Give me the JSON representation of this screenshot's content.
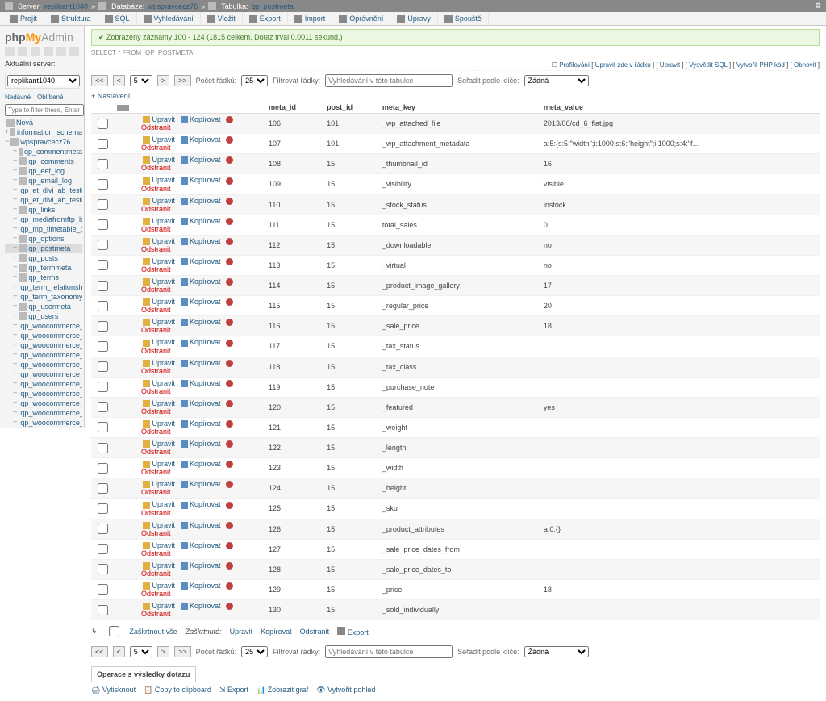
{
  "logo": {
    "php": "php",
    "my": "My",
    "admin": "Admin"
  },
  "header": {
    "server_label": "Server:",
    "server": "replikant1040",
    "db_label": "Databáze:",
    "db": "wpspravcecz76",
    "table_label": "Tabulka:",
    "table": "qp_postmeta"
  },
  "tabs": [
    "Projít",
    "Struktura",
    "SQL",
    "Vyhledávání",
    "Vložit",
    "Export",
    "Import",
    "Oprávnění",
    "Úpravy",
    "Spouště"
  ],
  "sidebar": {
    "current_server": "Aktuální server:",
    "server_value": "replikant1040",
    "smalltabs": [
      "Nedávné",
      "Oblíbené"
    ],
    "nova": "Nová",
    "filter_placeholder": "Type to filter these, Enter to search all",
    "dbs": [
      "information_schema",
      "wpspravcecz76"
    ],
    "tables": [
      "qp_commentmeta",
      "qp_comments",
      "qp_eef_log",
      "qp_email_log",
      "qp_et_divi_ab_testing_clienta",
      "qp_et_divi_ab_testing_stats",
      "qp_links",
      "qp_mediafromftp_log",
      "qp_mp_timetable_data",
      "qp_options",
      "qp_postmeta",
      "qp_posts",
      "qp_termmeta",
      "qp_terms",
      "qp_term_relationships",
      "qp_term_taxonomy",
      "qp_usermeta",
      "qp_users",
      "qp_woocommerce_api_keys",
      "qp_woocommerce_attribute_t",
      "qp_woocommerce_download",
      "qp_woocommerce_log",
      "qp_woocommerce_order_item",
      "qp_woocommerce_order_iten",
      "qp_woocommerce_payment_",
      "qp_woocommerce_sessions",
      "qp_woocommerce_shipping_",
      "qp_woocommerce_shipping_",
      "qp_woocommerce_shipping_",
      "qp_woocommerce_tax_rates",
      "qp_woocommerce_tax_rate_l"
    ],
    "selected_table": "qp_postmeta"
  },
  "success": "Zobrazeny záznamy 100 - 124 (1815 celkem, Dotaz trval 0.0011 sekund.)",
  "sql": "SELECT * FROM `qp_postmeta`",
  "profline": {
    "profiling": "Profilování",
    "inline": "Upravit zde v řádku",
    "upravit": "Upravit",
    "vysvetlit": "Vysvětlit SQL",
    "phpcode": "Vytvořit PHP kód",
    "obnovit": "Obnovit"
  },
  "navrow": {
    "page": "5",
    "rows_label": "Počet řádků:",
    "rows": "25",
    "filter_label": "Filtrovat řádky:",
    "filter_placeholder": "Vyhledávání v této tabulce",
    "sort_label": "Seřadit podle klíče:",
    "sort_value": "Žádná"
  },
  "settings": "Nastavení",
  "cols": [
    "",
    "",
    "",
    "meta_id",
    "post_id",
    "meta_key",
    "meta_value"
  ],
  "actions": {
    "edit": "Upravit",
    "copy": "Kopírovat",
    "del": "Odstranit"
  },
  "rows": [
    {
      "id": "106",
      "post": "101",
      "key": "_wp_attached_file",
      "val": "2013/06/cd_6_flat.jpg"
    },
    {
      "id": "107",
      "post": "101",
      "key": "_wp_attachment_metadata",
      "val": "a:5:{s:5:\"width\";i:1000;s:6:\"height\";i:1000;s:4:\"f…"
    },
    {
      "id": "108",
      "post": "15",
      "key": "_thumbnail_id",
      "val": "16"
    },
    {
      "id": "109",
      "post": "15",
      "key": "_visibility",
      "val": "visible"
    },
    {
      "id": "110",
      "post": "15",
      "key": "_stock_status",
      "val": "instock"
    },
    {
      "id": "111",
      "post": "15",
      "key": "total_sales",
      "val": "0"
    },
    {
      "id": "112",
      "post": "15",
      "key": "_downloadable",
      "val": "no"
    },
    {
      "id": "113",
      "post": "15",
      "key": "_virtual",
      "val": "no"
    },
    {
      "id": "114",
      "post": "15",
      "key": "_product_image_gallery",
      "val": "17"
    },
    {
      "id": "115",
      "post": "15",
      "key": "_regular_price",
      "val": "20"
    },
    {
      "id": "116",
      "post": "15",
      "key": "_sale_price",
      "val": "18"
    },
    {
      "id": "117",
      "post": "15",
      "key": "_tax_status",
      "val": ""
    },
    {
      "id": "118",
      "post": "15",
      "key": "_tax_class",
      "val": ""
    },
    {
      "id": "119",
      "post": "15",
      "key": "_purchase_note",
      "val": ""
    },
    {
      "id": "120",
      "post": "15",
      "key": "_featured",
      "val": "yes"
    },
    {
      "id": "121",
      "post": "15",
      "key": "_weight",
      "val": ""
    },
    {
      "id": "122",
      "post": "15",
      "key": "_length",
      "val": ""
    },
    {
      "id": "123",
      "post": "15",
      "key": "_width",
      "val": ""
    },
    {
      "id": "124",
      "post": "15",
      "key": "_height",
      "val": ""
    },
    {
      "id": "125",
      "post": "15",
      "key": "_sku",
      "val": ""
    },
    {
      "id": "126",
      "post": "15",
      "key": "_product_attributes",
      "val": "a:0:{}"
    },
    {
      "id": "127",
      "post": "15",
      "key": "_sale_price_dates_from",
      "val": ""
    },
    {
      "id": "128",
      "post": "15",
      "key": "_sale_price_dates_to",
      "val": ""
    },
    {
      "id": "129",
      "post": "15",
      "key": "_price",
      "val": "18"
    },
    {
      "id": "130",
      "post": "15",
      "key": "_sold_individually",
      "val": ""
    }
  ],
  "bottom": {
    "checkall": "Zaškrtnout vše",
    "withsel": "Zaškrtnuté:",
    "edit": "Upravit",
    "copy": "Kopírovat",
    "del": "Odstranit",
    "export": "Export"
  },
  "ops": {
    "title": "Operace s výsledky dotazu",
    "print": "Vytisknout",
    "clip": "Copy to clipboard",
    "export": "Export",
    "chart": "Zobrazit graf",
    "view": "Vytvořit pohled"
  }
}
